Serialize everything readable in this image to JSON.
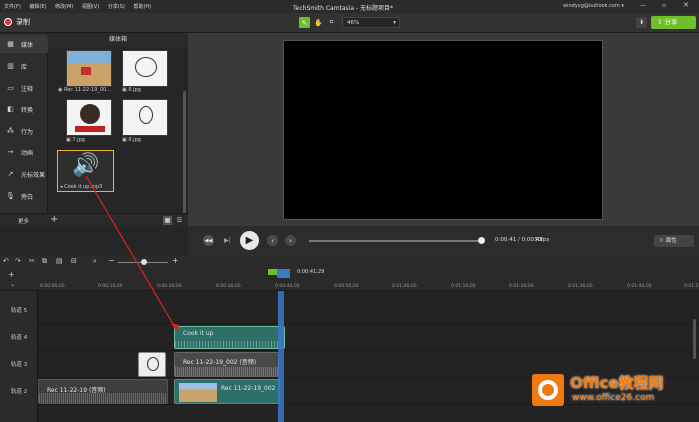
{
  "menu": [
    "文件(F)",
    "编辑(E)",
    "修改(M)",
    "视图(V)",
    "分享(S)",
    "帮助(H)"
  ],
  "window_title": "TechSmith Camtasia - 无标题项目*",
  "account": "windyvg@outlook.com ▾",
  "record_label": "录制",
  "zoom_value": "46%",
  "share_label": "分享",
  "nav": [
    "媒体",
    "库",
    "注释",
    "转换",
    "行为",
    "动画",
    "光标效果",
    "旁白"
  ],
  "more_label": "更多",
  "media_bin_title": "媒体箱",
  "media_items": [
    {
      "label": "Rec 11-22-19_00..."
    },
    {
      "label": "6.jpg"
    },
    {
      "label": "7.jpg"
    },
    {
      "label": "8.jpg"
    },
    {
      "label": "Cook it up.mp3"
    }
  ],
  "time_display": "0:00:41 / 0:00:41",
  "fps": "30fps",
  "properties_label": "属性",
  "playhead_time": "0:00:41;29",
  "ruler_ticks": [
    "0:00:00;00",
    "0:00:10;00",
    "0:00:20;00",
    "0:00:30;00",
    "0:00:40;00",
    "0:00:50;00",
    "0:01:00;00",
    "0:01:10;00",
    "0:01:20;00",
    "0:01:30;00",
    "0:01:40;00",
    "0:01:5"
  ],
  "tracks": [
    "轨道 5",
    "轨道 4",
    "轨道 3",
    "轨道 2"
  ],
  "clips": {
    "track4": "Cook it up",
    "track3": "Rec 11-22-19_002 (音频)",
    "track2_audio": "Rec 11-22-19 (音频)",
    "track2_video": "Rec 11-22-19_002"
  },
  "watermark": {
    "title": "Office教程网",
    "url": "www.office26.com"
  },
  "colors": {
    "accent_green": "#6fbf2a",
    "record_red": "#e03030",
    "clip_teal": "#2f6f6a",
    "clip_gray": "#4a4a4a",
    "playhead_blue": "#3a78c8",
    "arrow_red": "#e02020",
    "office_orange": "#f07a10"
  }
}
